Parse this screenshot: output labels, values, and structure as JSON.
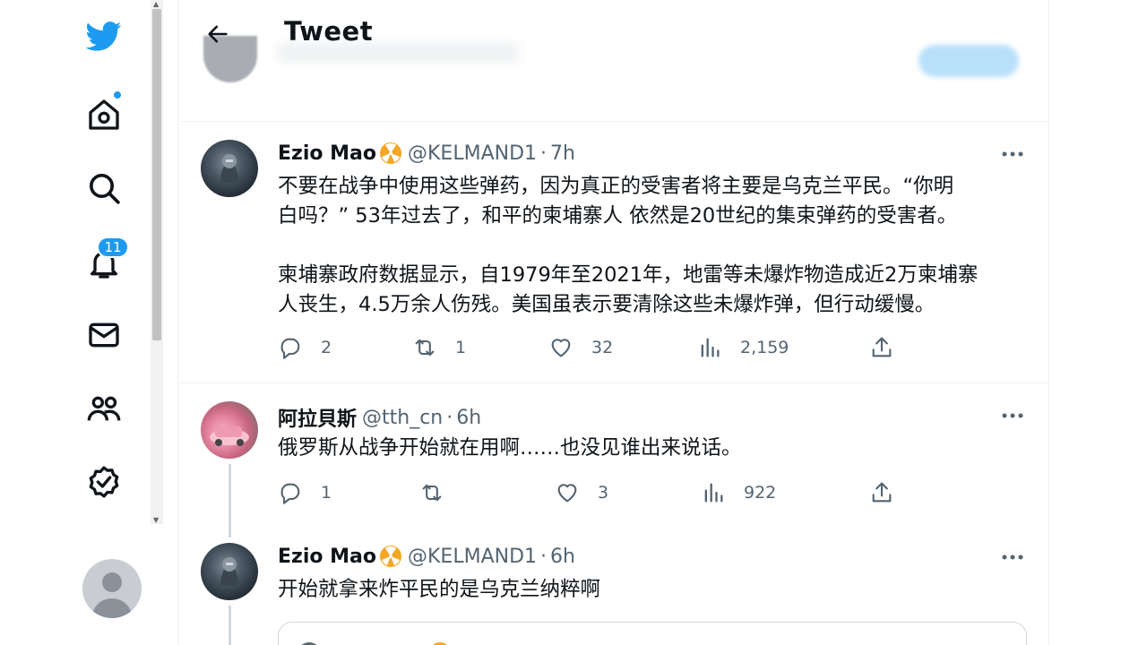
{
  "colors": {
    "accent": "#1d9bf0",
    "text": "#0f1419",
    "secondary": "#536471",
    "border": "#eff3f4"
  },
  "nav": {
    "items": [
      {
        "icon": "twitter-logo-icon"
      },
      {
        "icon": "home-icon"
      },
      {
        "icon": "search-icon"
      },
      {
        "icon": "notifications-bell-icon"
      },
      {
        "icon": "mail-icon"
      },
      {
        "icon": "communities-icon"
      },
      {
        "icon": "verified-icon"
      }
    ],
    "notifications_badge": "11"
  },
  "header": {
    "title": "Tweet"
  },
  "tweets": [
    {
      "name": "Ezio Mao",
      "handle": "@KELMAND1",
      "sep": "·",
      "time": "7h",
      "text_lines": [
        "不要在战争中使用这些弹药，因为真正的受害者将主要是乌克兰平民。“你明",
        "白吗？” 53年过去了，和平的柬埔寨人 依然是20世纪的集束弹药的受害者。",
        "",
        "柬埔寨政府数据显示，自1979年至2021年，地雷等未爆炸物造成近2万柬埔寨",
        "人丧生，4.5万余人伤残。美国虽表示要清除这些未爆炸弹，但行动缓慢。"
      ],
      "replies": "2",
      "retweets": "1",
      "likes": "32",
      "views": "2,159"
    },
    {
      "name": "阿拉貝斯",
      "handle": "@tth_cn",
      "sep": "·",
      "time": "6h",
      "text_lines": [
        "俄罗斯从战争开始就在用啊……也没见谁出来说话。"
      ],
      "replies": "1",
      "retweets": "",
      "likes": "3",
      "views": "922"
    },
    {
      "name": "Ezio Mao",
      "handle": "@KELMAND1",
      "sep": "·",
      "time": "6h",
      "text_lines": [
        "开始就拿来炸平民的是乌克兰纳粹啊"
      ]
    }
  ]
}
